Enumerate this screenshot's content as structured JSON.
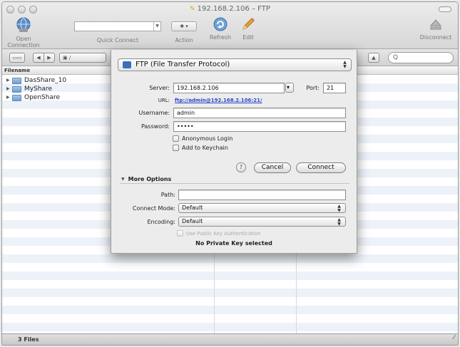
{
  "window": {
    "title": "192.168.2.106 – FTP"
  },
  "toolbar": {
    "open_connection": "Open Connection",
    "quick_connect": "Quick Connect",
    "action": "Action",
    "refresh": "Refresh",
    "edit": "Edit",
    "disconnect": "Disconnect"
  },
  "navbar": {
    "path": "/",
    "search_glyph": "Q"
  },
  "browser": {
    "column_header": "Filename",
    "files": [
      {
        "name": "DasShare_10"
      },
      {
        "name": "MyShare"
      },
      {
        "name": "OpenShare"
      }
    ],
    "status": "3 Files"
  },
  "dialog": {
    "protocol": "FTP (File Transfer Protocol)",
    "server_label": "Server:",
    "server_value": "192.168.2.106",
    "port_label": "Port:",
    "port_value": "21",
    "url_label": "URL:",
    "url_value": "ftp://admin@192.168.2.106:21/",
    "username_label": "Username:",
    "username_value": "admin",
    "password_label": "Password:",
    "password_value": "•••••",
    "anonymous_label": "Anonymous Login",
    "keychain_label": "Add to Keychain",
    "help_glyph": "?",
    "cancel": "Cancel",
    "connect": "Connect",
    "more_options": "More Options",
    "path_label": "Path:",
    "path_value": "",
    "connect_mode_label": "Connect Mode:",
    "connect_mode_value": "Default",
    "encoding_label": "Encoding:",
    "encoding_value": "Default",
    "public_key_label": "Use Public Key Authentication",
    "no_private_key": "No Private Key selected"
  },
  "colors": {
    "link": "#2b49c6",
    "row_stripe": "#edf2f9",
    "folder": "#6f9ed0"
  }
}
